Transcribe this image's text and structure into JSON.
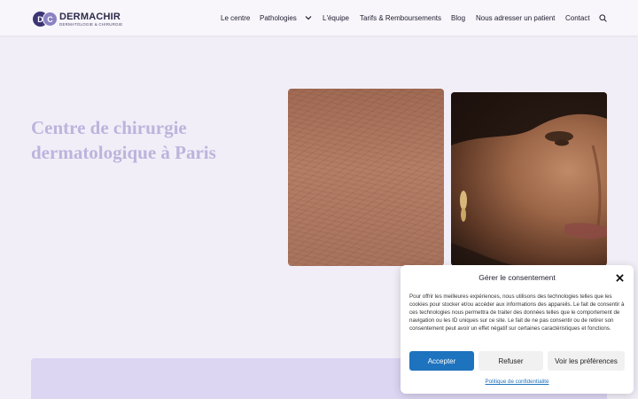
{
  "header": {
    "logo": {
      "mark_left": "D",
      "mark_right": "C",
      "name": "DERMACHIR",
      "subtitle": "DERMATOLOGIE & CHIRURGIE"
    },
    "nav": [
      {
        "label": "Le centre"
      },
      {
        "label": "Pathologies",
        "has_dropdown": true
      },
      {
        "label": "L'équipe"
      },
      {
        "label": "Tarifs & Remboursements"
      },
      {
        "label": "Blog"
      },
      {
        "label": "Nous adresser un patient"
      },
      {
        "label": "Contact"
      }
    ],
    "icons": {
      "dropdown": "chevron-down-icon",
      "search": "search-icon"
    }
  },
  "hero": {
    "title": "Centre de chirurgie dermatologique à Paris",
    "images": [
      {
        "name": "skin-texture-image"
      },
      {
        "name": "woman-face-image"
      }
    ]
  },
  "consent": {
    "title": "Gérer le consentement",
    "body": "Pour offrir les meilleures expériences, nous utilisons des technologies telles que les cookies pour stocker et/ou accéder aux informations des appareils. Le fait de consentir à ces technologies nous permettra de traiter des données telles que le comportement de navigation ou les ID uniques sur ce site. Le fait de ne pas consentir ou de retirer son consentement peut avoir un effet négatif sur certaines caractéristiques et fonctions.",
    "accept_label": "Accepter",
    "refuse_label": "Refuser",
    "prefs_label": "Voir les préférences",
    "policy_label": "Politique de confidentialité"
  },
  "colors": {
    "background": "#f2eef8",
    "brand": "#3b3575",
    "hero_title": "#bdb4dc",
    "accept_button": "#1e73be",
    "band": "#dcd6f3"
  }
}
